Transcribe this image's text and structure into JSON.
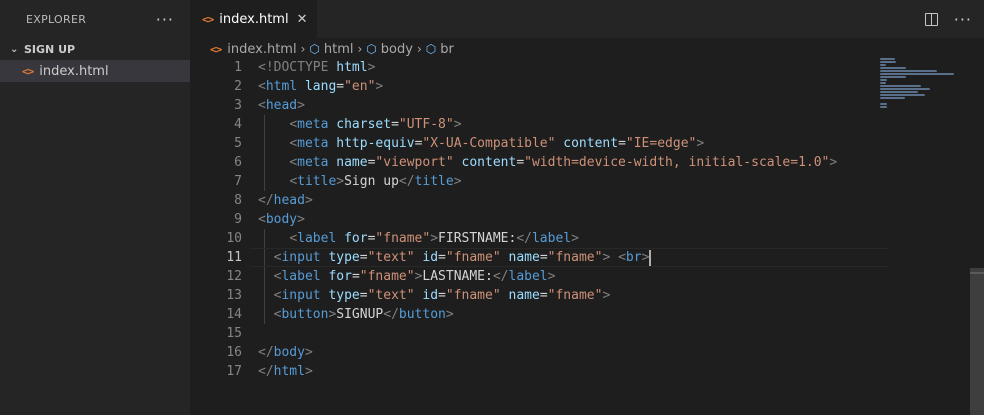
{
  "sidebar": {
    "title": "EXPLORER",
    "more_label": "···",
    "section": "SIGN UP",
    "chevron": "⌄",
    "files": [
      {
        "name": "index.html",
        "icon": "html-file-icon"
      }
    ]
  },
  "tabs": [
    {
      "label": "index.html",
      "close": "✕",
      "active": true
    }
  ],
  "breadcrumb": [
    "index.html",
    "html",
    "body",
    "br"
  ],
  "editor": {
    "active_line": 11,
    "line_numbers": [
      "1",
      "2",
      "3",
      "4",
      "5",
      "6",
      "7",
      "8",
      "9",
      "10",
      "11",
      "12",
      "13",
      "14",
      "15",
      "16",
      "17"
    ],
    "lines": [
      [
        {
          "t": "<!DOCTYPE ",
          "c": "#808080"
        },
        {
          "t": "html",
          "c": "#9cdcfe"
        },
        {
          "t": ">",
          "c": "#808080"
        }
      ],
      [
        {
          "t": "<",
          "c": "#808080"
        },
        {
          "t": "html ",
          "c": "#569cd6"
        },
        {
          "t": "lang",
          "c": "#9cdcfe"
        },
        {
          "t": "=",
          "c": "#d4d4d4"
        },
        {
          "t": "\"en\"",
          "c": "#ce9178"
        },
        {
          "t": ">",
          "c": "#808080"
        }
      ],
      [
        {
          "t": "<",
          "c": "#808080"
        },
        {
          "t": "head",
          "c": "#569cd6"
        },
        {
          "t": ">",
          "c": "#808080"
        }
      ],
      [
        {
          "t": "    ",
          "c": "#d4d4d4"
        },
        {
          "t": "<",
          "c": "#808080"
        },
        {
          "t": "meta ",
          "c": "#569cd6"
        },
        {
          "t": "charset",
          "c": "#9cdcfe"
        },
        {
          "t": "=",
          "c": "#d4d4d4"
        },
        {
          "t": "\"UTF-8\"",
          "c": "#ce9178"
        },
        {
          "t": ">",
          "c": "#808080"
        }
      ],
      [
        {
          "t": "    ",
          "c": "#d4d4d4"
        },
        {
          "t": "<",
          "c": "#808080"
        },
        {
          "t": "meta ",
          "c": "#569cd6"
        },
        {
          "t": "http-equiv",
          "c": "#9cdcfe"
        },
        {
          "t": "=",
          "c": "#d4d4d4"
        },
        {
          "t": "\"X-UA-Compatible\" ",
          "c": "#ce9178"
        },
        {
          "t": "content",
          "c": "#9cdcfe"
        },
        {
          "t": "=",
          "c": "#d4d4d4"
        },
        {
          "t": "\"IE=edge\"",
          "c": "#ce9178"
        },
        {
          "t": ">",
          "c": "#808080"
        }
      ],
      [
        {
          "t": "    ",
          "c": "#d4d4d4"
        },
        {
          "t": "<",
          "c": "#808080"
        },
        {
          "t": "meta ",
          "c": "#569cd6"
        },
        {
          "t": "name",
          "c": "#9cdcfe"
        },
        {
          "t": "=",
          "c": "#d4d4d4"
        },
        {
          "t": "\"viewport\" ",
          "c": "#ce9178"
        },
        {
          "t": "content",
          "c": "#9cdcfe"
        },
        {
          "t": "=",
          "c": "#d4d4d4"
        },
        {
          "t": "\"width=device-width, initial-scale=1.0\"",
          "c": "#ce9178"
        },
        {
          "t": ">",
          "c": "#808080"
        }
      ],
      [
        {
          "t": "    ",
          "c": "#d4d4d4"
        },
        {
          "t": "<",
          "c": "#808080"
        },
        {
          "t": "title",
          "c": "#569cd6"
        },
        {
          "t": ">",
          "c": "#808080"
        },
        {
          "t": "Sign up",
          "c": "#d4d4d4"
        },
        {
          "t": "</",
          "c": "#808080"
        },
        {
          "t": "title",
          "c": "#569cd6"
        },
        {
          "t": ">",
          "c": "#808080"
        }
      ],
      [
        {
          "t": "</",
          "c": "#808080"
        },
        {
          "t": "head",
          "c": "#569cd6"
        },
        {
          "t": ">",
          "c": "#808080"
        }
      ],
      [
        {
          "t": "<",
          "c": "#808080"
        },
        {
          "t": "body",
          "c": "#569cd6"
        },
        {
          "t": ">",
          "c": "#808080"
        }
      ],
      [
        {
          "t": "    ",
          "c": "#d4d4d4"
        },
        {
          "t": "<",
          "c": "#808080"
        },
        {
          "t": "label ",
          "c": "#569cd6"
        },
        {
          "t": "for",
          "c": "#9cdcfe"
        },
        {
          "t": "=",
          "c": "#d4d4d4"
        },
        {
          "t": "\"fname\"",
          "c": "#ce9178"
        },
        {
          "t": ">",
          "c": "#808080"
        },
        {
          "t": "FIRSTNAME:",
          "c": "#d4d4d4"
        },
        {
          "t": "</",
          "c": "#808080"
        },
        {
          "t": "label",
          "c": "#569cd6"
        },
        {
          "t": ">",
          "c": "#808080"
        }
      ],
      [
        {
          "t": "  ",
          "c": "#d4d4d4"
        },
        {
          "t": "<",
          "c": "#808080"
        },
        {
          "t": "input ",
          "c": "#569cd6"
        },
        {
          "t": "type",
          "c": "#9cdcfe"
        },
        {
          "t": "=",
          "c": "#d4d4d4"
        },
        {
          "t": "\"text\" ",
          "c": "#ce9178"
        },
        {
          "t": "id",
          "c": "#9cdcfe"
        },
        {
          "t": "=",
          "c": "#d4d4d4"
        },
        {
          "t": "\"fname\" ",
          "c": "#ce9178"
        },
        {
          "t": "name",
          "c": "#9cdcfe"
        },
        {
          "t": "=",
          "c": "#d4d4d4"
        },
        {
          "t": "\"fname\"",
          "c": "#ce9178"
        },
        {
          "t": "> ",
          "c": "#808080"
        },
        {
          "t": "<",
          "c": "#808080"
        },
        {
          "t": "br",
          "c": "#569cd6"
        },
        {
          "t": ">",
          "c": "#808080"
        }
      ],
      [
        {
          "t": "  ",
          "c": "#d4d4d4"
        },
        {
          "t": "<",
          "c": "#808080"
        },
        {
          "t": "label ",
          "c": "#569cd6"
        },
        {
          "t": "for",
          "c": "#9cdcfe"
        },
        {
          "t": "=",
          "c": "#d4d4d4"
        },
        {
          "t": "\"fname\"",
          "c": "#ce9178"
        },
        {
          "t": ">",
          "c": "#808080"
        },
        {
          "t": "LASTNAME:",
          "c": "#d4d4d4"
        },
        {
          "t": "</",
          "c": "#808080"
        },
        {
          "t": "label",
          "c": "#569cd6"
        },
        {
          "t": ">",
          "c": "#808080"
        }
      ],
      [
        {
          "t": "  ",
          "c": "#d4d4d4"
        },
        {
          "t": "<",
          "c": "#808080"
        },
        {
          "t": "input ",
          "c": "#569cd6"
        },
        {
          "t": "type",
          "c": "#9cdcfe"
        },
        {
          "t": "=",
          "c": "#d4d4d4"
        },
        {
          "t": "\"text\" ",
          "c": "#ce9178"
        },
        {
          "t": "id",
          "c": "#9cdcfe"
        },
        {
          "t": "=",
          "c": "#d4d4d4"
        },
        {
          "t": "\"fname\" ",
          "c": "#ce9178"
        },
        {
          "t": "name",
          "c": "#9cdcfe"
        },
        {
          "t": "=",
          "c": "#d4d4d4"
        },
        {
          "t": "\"fname\"",
          "c": "#ce9178"
        },
        {
          "t": ">",
          "c": "#808080"
        }
      ],
      [
        {
          "t": "  ",
          "c": "#d4d4d4"
        },
        {
          "t": "<",
          "c": "#808080"
        },
        {
          "t": "button",
          "c": "#569cd6"
        },
        {
          "t": ">",
          "c": "#808080"
        },
        {
          "t": "SIGNUP",
          "c": "#d4d4d4"
        },
        {
          "t": "</",
          "c": "#808080"
        },
        {
          "t": "button",
          "c": "#569cd6"
        },
        {
          "t": ">",
          "c": "#808080"
        }
      ],
      [],
      [
        {
          "t": "</",
          "c": "#808080"
        },
        {
          "t": "body",
          "c": "#569cd6"
        },
        {
          "t": ">",
          "c": "#808080"
        }
      ],
      [
        {
          "t": "</",
          "c": "#808080"
        },
        {
          "t": "html",
          "c": "#569cd6"
        },
        {
          "t": ">",
          "c": "#808080"
        }
      ]
    ]
  },
  "colors": {
    "accent": "#e37933",
    "background": "#1e1e1e",
    "sidebar": "#252526"
  }
}
